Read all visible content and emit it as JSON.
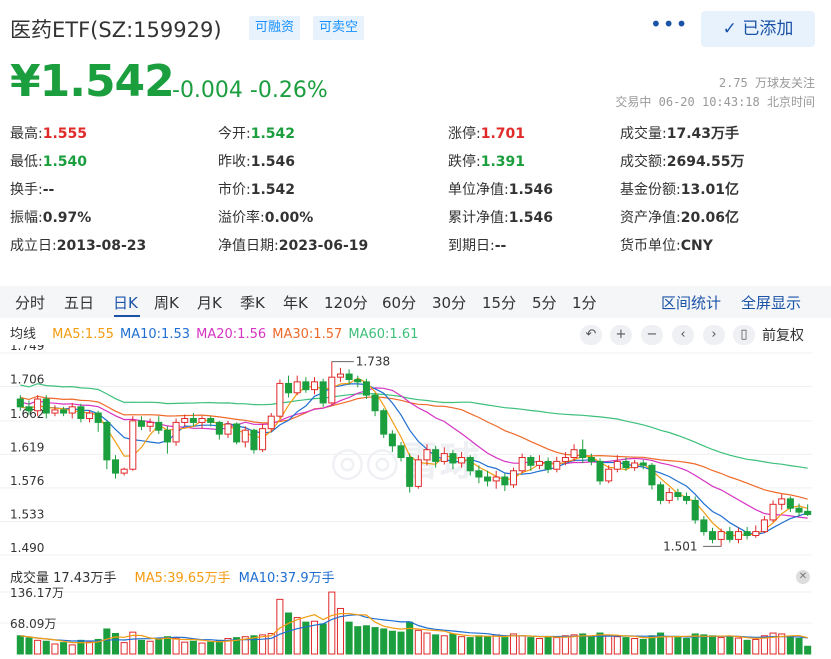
{
  "header": {
    "title": "医药ETF(SZ:159929)",
    "tags": [
      "可融资",
      "可卖空"
    ],
    "added_label": "已添加",
    "price": "¥1.542",
    "change": "-0.004",
    "change_pct": "-0.26%",
    "followers": "2.75 万球友关注",
    "status": "交易中 06-20 10:43:18 北京时间"
  },
  "quote": {
    "col1": [
      {
        "label": "最高:",
        "value": "1.555",
        "color": "red"
      },
      {
        "label": "最低:",
        "value": "1.540",
        "color": "green"
      },
      {
        "label": "换手:",
        "value": "--",
        "color": ""
      },
      {
        "label": "振幅:",
        "value": "0.97%",
        "color": ""
      },
      {
        "label": "成立日:",
        "value": "2013-08-23",
        "color": ""
      }
    ],
    "col2": [
      {
        "label": "今开:",
        "value": "1.542",
        "color": "green"
      },
      {
        "label": "昨收:",
        "value": "1.546",
        "color": ""
      },
      {
        "label": "市价:",
        "value": "1.542",
        "color": ""
      },
      {
        "label": "溢价率:",
        "value": "0.00%",
        "color": ""
      },
      {
        "label": "净值日期:",
        "value": "2023-06-19",
        "color": ""
      }
    ],
    "col3": [
      {
        "label": "涨停:",
        "value": "1.701",
        "color": "red"
      },
      {
        "label": "跌停:",
        "value": "1.391",
        "color": "green"
      },
      {
        "label": "单位净值:",
        "value": "1.546",
        "color": ""
      },
      {
        "label": "累计净值:",
        "value": "1.546",
        "color": ""
      },
      {
        "label": "到期日:",
        "value": "--",
        "color": ""
      }
    ],
    "col4": [
      {
        "label": "成交量:",
        "value": "17.43万手",
        "color": ""
      },
      {
        "label": "成交额:",
        "value": "2694.55万",
        "color": ""
      },
      {
        "label": "基金份额:",
        "value": "13.01亿",
        "color": ""
      },
      {
        "label": "资产净值:",
        "value": "20.06亿",
        "color": ""
      },
      {
        "label": "货币单位:",
        "value": "CNY",
        "color": ""
      }
    ]
  },
  "tabs": [
    "分时",
    "五日",
    "日K",
    "周K",
    "月K",
    "季K",
    "年K",
    "120分",
    "60分",
    "30分",
    "15分",
    "5分",
    "1分"
  ],
  "active_tab": "日K",
  "links": {
    "range_stats": "区间统计",
    "fullscreen": "全屏显示"
  },
  "ma_legend": {
    "label": "均线",
    "ma5": "MA5:1.55",
    "ma10": "MA10:1.53",
    "ma20": "MA20:1.56",
    "ma30": "MA30:1.57",
    "ma60": "MA60:1.61"
  },
  "restore_label": "前复权",
  "vol_legend": {
    "label": "成交量 17.43万手",
    "ma5": "MA5:39.65万手",
    "ma10": "MA10:37.9万手"
  },
  "colors": {
    "up": "#e02a2a",
    "down": "#1b9e3e",
    "ma5": "#f39c12",
    "ma10": "#1f6fd1",
    "ma20": "#d633c2",
    "ma30": "#ef6a2a",
    "ma60": "#3cc07a",
    "accent": "#1b53a7"
  },
  "chart_data": {
    "type": "candlestick",
    "price_ticks": [
      "1.749",
      "1.706",
      "1.662",
      "1.619",
      "1.576",
      "1.533",
      "1.490"
    ],
    "volume_ticks": [
      "136.17万",
      "68.09万"
    ],
    "high_annotation": "1.738",
    "low_annotation": "1.501",
    "ylim": [
      1.49,
      1.749
    ],
    "candles": [
      [
        1.69,
        1.68,
        1.695,
        1.675
      ],
      [
        1.68,
        1.675,
        1.688,
        1.67
      ],
      [
        1.675,
        1.69,
        1.695,
        1.668
      ],
      [
        1.69,
        1.672,
        1.695,
        1.665
      ],
      [
        1.672,
        1.676,
        1.682,
        1.668
      ],
      [
        1.676,
        1.672,
        1.68,
        1.668
      ],
      [
        1.672,
        1.68,
        1.685,
        1.665
      ],
      [
        1.68,
        1.665,
        1.684,
        1.66
      ],
      [
        1.665,
        1.672,
        1.676,
        1.66
      ],
      [
        1.672,
        1.66,
        1.675,
        1.648
      ],
      [
        1.66,
        1.612,
        1.662,
        1.6
      ],
      [
        1.612,
        1.595,
        1.618,
        1.588
      ],
      [
        1.595,
        1.6,
        1.602,
        1.592
      ],
      [
        1.6,
        1.662,
        1.668,
        1.598
      ],
      [
        1.662,
        1.655,
        1.668,
        1.65
      ],
      [
        1.655,
        1.66,
        1.665,
        1.648
      ],
      [
        1.66,
        1.65,
        1.668,
        1.645
      ],
      [
        1.65,
        1.635,
        1.655,
        1.62
      ],
      [
        1.635,
        1.66,
        1.665,
        1.63
      ],
      [
        1.66,
        1.665,
        1.67,
        1.655
      ],
      [
        1.665,
        1.66,
        1.672,
        1.655
      ],
      [
        1.66,
        1.665,
        1.668,
        1.652
      ],
      [
        1.665,
        1.66,
        1.668,
        1.655
      ],
      [
        1.66,
        1.645,
        1.662,
        1.638
      ],
      [
        1.645,
        1.658,
        1.662,
        1.64
      ],
      [
        1.658,
        1.635,
        1.66,
        1.632
      ],
      [
        1.635,
        1.65,
        1.655,
        1.628
      ],
      [
        1.65,
        1.625,
        1.652,
        1.62
      ],
      [
        1.625,
        1.652,
        1.658,
        1.622
      ],
      [
        1.652,
        1.668,
        1.672,
        1.648
      ],
      [
        1.668,
        1.71,
        1.715,
        1.665
      ],
      [
        1.71,
        1.698,
        1.72,
        1.692
      ],
      [
        1.698,
        1.712,
        1.72,
        1.695
      ],
      [
        1.712,
        1.702,
        1.718,
        1.698
      ],
      [
        1.702,
        1.712,
        1.718,
        1.696
      ],
      [
        1.712,
        1.685,
        1.716,
        1.68
      ],
      [
        1.685,
        1.718,
        1.738,
        1.682
      ],
      [
        1.718,
        1.722,
        1.73,
        1.712
      ],
      [
        1.722,
        1.715,
        1.728,
        1.708
      ],
      [
        1.715,
        1.712,
        1.72,
        1.705
      ],
      [
        1.712,
        1.695,
        1.716,
        1.69
      ],
      [
        1.695,
        1.675,
        1.698,
        1.668
      ],
      [
        1.675,
        1.645,
        1.678,
        1.64
      ],
      [
        1.645,
        1.63,
        1.65,
        1.622
      ],
      [
        1.63,
        1.615,
        1.635,
        1.61
      ],
      [
        1.615,
        1.578,
        1.62,
        1.57
      ],
      [
        1.578,
        1.612,
        1.618,
        1.575
      ],
      [
        1.612,
        1.625,
        1.632,
        1.605
      ],
      [
        1.625,
        1.61,
        1.63,
        1.602
      ],
      [
        1.61,
        1.62,
        1.628,
        1.606
      ],
      [
        1.62,
        1.608,
        1.625,
        1.6
      ],
      [
        1.608,
        1.615,
        1.622,
        1.602
      ],
      [
        1.615,
        1.598,
        1.618,
        1.592
      ],
      [
        1.598,
        1.59,
        1.605,
        1.582
      ],
      [
        1.59,
        1.585,
        1.598,
        1.578
      ],
      [
        1.585,
        1.59,
        1.598,
        1.575
      ],
      [
        1.59,
        1.58,
        1.595,
        1.572
      ],
      [
        1.58,
        1.598,
        1.602,
        1.576
      ],
      [
        1.598,
        1.615,
        1.62,
        1.595
      ],
      [
        1.615,
        1.605,
        1.618,
        1.598
      ],
      [
        1.605,
        1.61,
        1.618,
        1.6
      ],
      [
        1.61,
        1.6,
        1.615,
        1.595
      ],
      [
        1.6,
        1.61,
        1.616,
        1.596
      ],
      [
        1.61,
        1.615,
        1.622,
        1.605
      ],
      [
        1.615,
        1.625,
        1.632,
        1.61
      ],
      [
        1.625,
        1.615,
        1.638,
        1.608
      ],
      [
        1.615,
        1.61,
        1.62,
        1.605
      ],
      [
        1.61,
        1.585,
        1.614,
        1.58
      ],
      [
        1.585,
        1.6,
        1.605,
        1.582
      ],
      [
        1.6,
        1.61,
        1.618,
        1.596
      ],
      [
        1.61,
        1.602,
        1.615,
        1.598
      ],
      [
        1.602,
        1.608,
        1.612,
        1.598
      ],
      [
        1.608,
        1.605,
        1.612,
        1.6
      ],
      [
        1.605,
        1.58,
        1.608,
        1.574
      ],
      [
        1.58,
        1.56,
        1.584,
        1.555
      ],
      [
        1.56,
        1.57,
        1.576,
        1.556
      ],
      [
        1.57,
        1.565,
        1.575,
        1.56
      ],
      [
        1.565,
        1.56,
        1.57,
        1.555
      ],
      [
        1.56,
        1.535,
        1.565,
        1.53
      ],
      [
        1.535,
        1.52,
        1.54,
        1.515
      ],
      [
        1.52,
        1.51,
        1.525,
        1.505
      ],
      [
        1.51,
        1.52,
        1.524,
        1.501
      ],
      [
        1.52,
        1.51,
        1.526,
        1.506
      ],
      [
        1.51,
        1.52,
        1.525,
        1.505
      ],
      [
        1.52,
        1.515,
        1.526,
        1.51
      ],
      [
        1.515,
        1.52,
        1.528,
        1.512
      ],
      [
        1.52,
        1.535,
        1.54,
        1.518
      ],
      [
        1.535,
        1.555,
        1.56,
        1.532
      ],
      [
        1.555,
        1.562,
        1.568,
        1.548
      ],
      [
        1.562,
        1.55,
        1.565,
        1.545
      ],
      [
        1.55,
        1.545,
        1.556,
        1.54
      ],
      [
        1.546,
        1.542,
        1.555,
        1.54
      ]
    ],
    "volumes": [
      40,
      35,
      30,
      28,
      22,
      25,
      20,
      30,
      26,
      32,
      55,
      45,
      25,
      48,
      30,
      28,
      32,
      38,
      35,
      26,
      28,
      24,
      26,
      30,
      34,
      36,
      38,
      40,
      42,
      45,
      120,
      90,
      80,
      70,
      72,
      66,
      136,
      100,
      70,
      60,
      62,
      58,
      55,
      50,
      48,
      70,
      52,
      46,
      42,
      40,
      44,
      38,
      36,
      40,
      38,
      42,
      36,
      44,
      40,
      36,
      34,
      38,
      36,
      40,
      42,
      44,
      38,
      46,
      40,
      38,
      36,
      34,
      32,
      40,
      46,
      38,
      36,
      34,
      44,
      42,
      40,
      36,
      38,
      35,
      30,
      32,
      40,
      46,
      44,
      38,
      34,
      17
    ]
  }
}
